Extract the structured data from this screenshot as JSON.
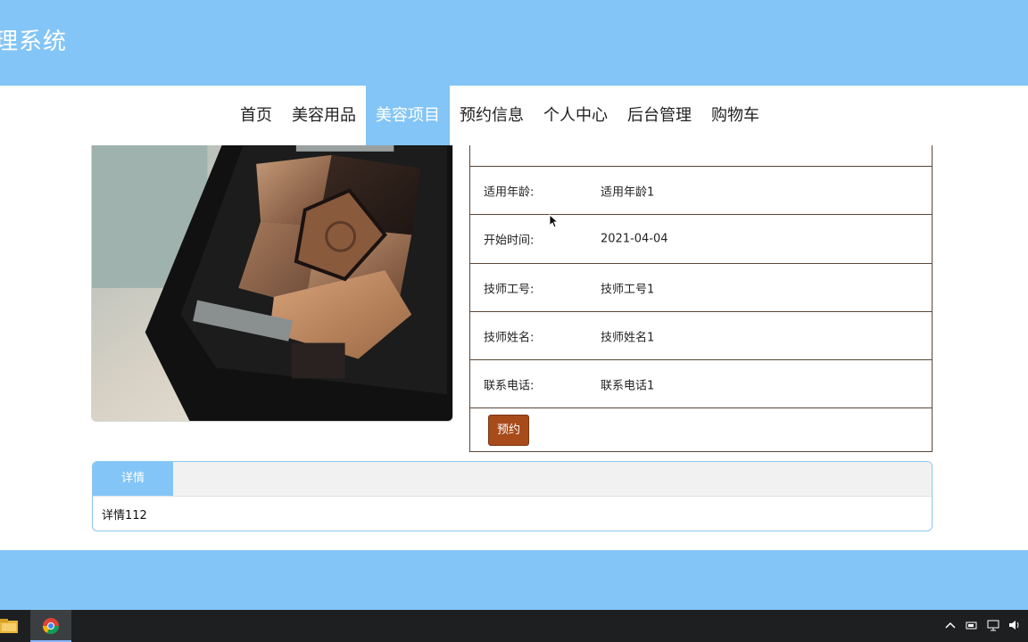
{
  "header": {
    "title": "理系统"
  },
  "nav": {
    "items": [
      {
        "label": "首页",
        "active": false
      },
      {
        "label": "美容用品",
        "active": false
      },
      {
        "label": "美容项目",
        "active": true
      },
      {
        "label": "预约信息",
        "active": false
      },
      {
        "label": "个人中心",
        "active": false
      },
      {
        "label": "后台管理",
        "active": false
      },
      {
        "label": "购物车",
        "active": false
      }
    ]
  },
  "product": {
    "image_icon": "eyeshadow-palette-photo",
    "info": [
      {
        "label": "适用年龄:",
        "value": "适用年龄1"
      },
      {
        "label": "开始时间:",
        "value": "2021-04-04"
      },
      {
        "label": "技师工号:",
        "value": "技师工号1"
      },
      {
        "label": "技师姓名:",
        "value": "技师姓名1"
      },
      {
        "label": "联系电话:",
        "value": "联系电话1"
      }
    ],
    "reserve_label": "预约"
  },
  "detail": {
    "tab_label": "详情",
    "content": "详情112"
  },
  "colors": {
    "accent": "#83c5f6",
    "button": "#a84b1b",
    "border": "#5b4636"
  },
  "taskbar": {
    "icons": [
      "folder-icon",
      "chrome-icon",
      "chevron-up-icon",
      "battery-icon",
      "network-icon",
      "volume-icon"
    ]
  }
}
